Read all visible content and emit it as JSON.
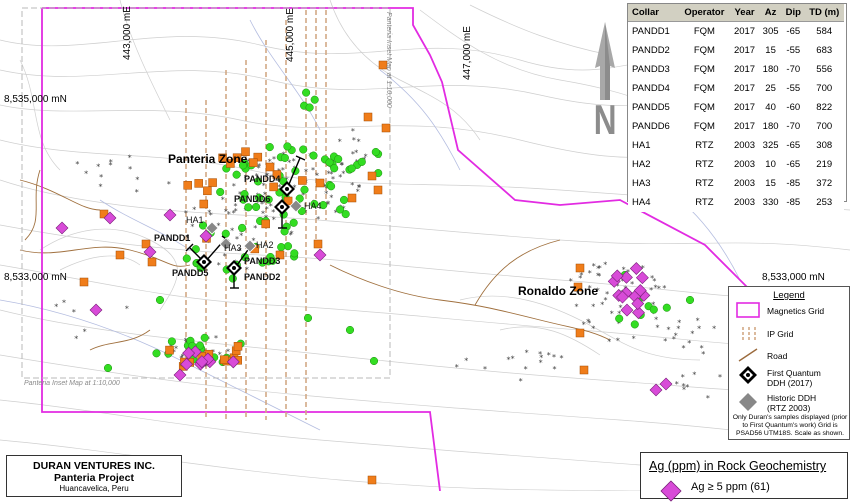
{
  "map": {
    "easting_labels": [
      "443,000 mE",
      "445,000 mE",
      "447,000 mE"
    ],
    "northing_labels": [
      "8,535,000 mN",
      "8,533,000 mN",
      "8,533,000 mN"
    ],
    "inset_label_top": "Panteria Inset Map at 1:10,000",
    "inset_label_bottom": "Panteria Inset Map at 1:10,000",
    "zones": {
      "panteria": "Panteria Zone",
      "ronaldo": "Ronaldo Zone"
    },
    "north_letter": "N",
    "holes": [
      "PANDD4",
      "PANDD6",
      "HA4",
      "HA1",
      "PANDD1",
      "HA3",
      "HA2",
      "PANDD5",
      "PANDD3",
      "PANDD2"
    ],
    "colors": {
      "magnetics_grid": "#e22be2",
      "ip_grid": "#c8a27a",
      "road": "#9b6a3c",
      "contour": "#c9c9c9",
      "drainage": "#aab6dd",
      "green_sample": "#33dd22",
      "orange_sample": "#f07d1a",
      "magenta_sample": "#d84bd8"
    }
  },
  "collar_table": {
    "headers": [
      "Collar",
      "Operator",
      "Year",
      "Az",
      "Dip",
      "TD (m)"
    ],
    "rows": [
      [
        "PANDD1",
        "FQM",
        "2017",
        "305",
        "-65",
        "584"
      ],
      [
        "PANDD2",
        "FQM",
        "2017",
        "15",
        "-55",
        "683"
      ],
      [
        "PANDD3",
        "FQM",
        "2017",
        "180",
        "-70",
        "556"
      ],
      [
        "PANDD4",
        "FQM",
        "2017",
        "25",
        "-55",
        "700"
      ],
      [
        "PANDD5",
        "FQM",
        "2017",
        "40",
        "-60",
        "822"
      ],
      [
        "PANDD6",
        "FQM",
        "2017",
        "180",
        "-70",
        "700"
      ],
      [
        "HA1",
        "RTZ",
        "2003",
        "325",
        "-65",
        "308"
      ],
      [
        "HA2",
        "RTZ",
        "2003",
        "10",
        "-65",
        "219"
      ],
      [
        "HA3",
        "RTZ",
        "2003",
        "15",
        "-85",
        "372"
      ],
      [
        "HA4",
        "RTZ",
        "2003",
        "330",
        "-85",
        "253"
      ]
    ]
  },
  "legend": {
    "title": "Legend",
    "magnetics": "Magnetics Grid",
    "ip": "IP Grid",
    "road": "Road",
    "fq_line1": "First Quantum",
    "fq_line2": "DDH (2017)",
    "hist_line1": "Historic DDH",
    "hist_line2": "(RTZ 2003)",
    "note": "Only Duran's samples displayed (prior to First Quantum's work) Grid is PSAD56 UTM18S. Scale as shown."
  },
  "title_box": {
    "company": "DURAN VENTURES INC.",
    "project": "Panteria Project",
    "location": "Huancavelica, Peru"
  },
  "geochem": {
    "title": "Ag (ppm) in Rock Geochemistry",
    "item": "Ag ≥ 5 ppm (61)"
  }
}
